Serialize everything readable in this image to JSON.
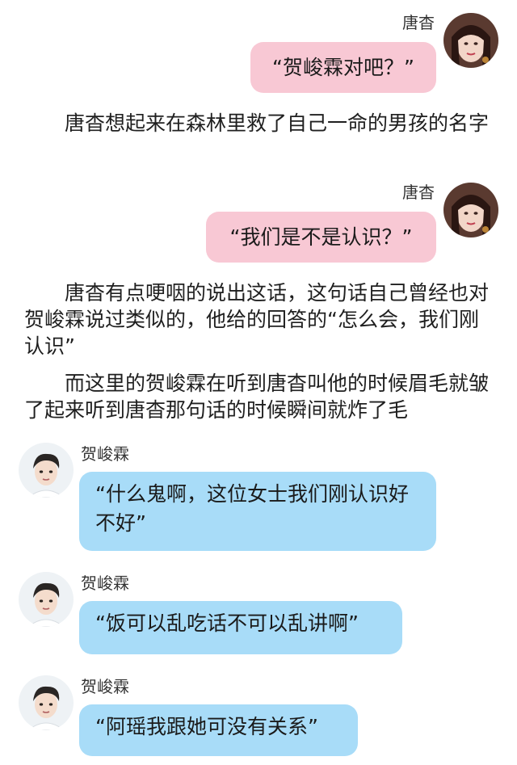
{
  "messages": [
    {
      "speaker": "唐杳",
      "text": "“贺峻霖对吧？”"
    },
    {
      "speaker": "唐杳",
      "text": "“我们是不是认识？”"
    },
    {
      "speaker": "贺峻霖",
      "text": "“什么鬼啊，这位女士我们刚认识好不好”"
    },
    {
      "speaker": "贺峻霖",
      "text": "“饭可以乱吃话不可以乱讲啊”"
    },
    {
      "speaker": "贺峻霖",
      "text": "“阿瑶我跟她可没有关系”"
    }
  ],
  "narration": [
    "唐杳想起来在森林里救了自己一命的男孩的名字",
    "唐杳有点哽咽的说出这话，这句话自己曾经也对贺峻霖说过类似的，他给的回答的“怎么会，我们刚认识”",
    "而这里的贺峻霖在听到唐杳叫他的时候眉毛就皱了起来听到唐杳那句话的时候瞬间就炸了毛"
  ],
  "colors": {
    "right_bubble": "#f8c8d4",
    "left_bubble": "#a8dcf8"
  },
  "icons": {
    "right_avatar": "tangyao-avatar-icon",
    "left_avatar": "hejunlin-avatar-icon"
  }
}
